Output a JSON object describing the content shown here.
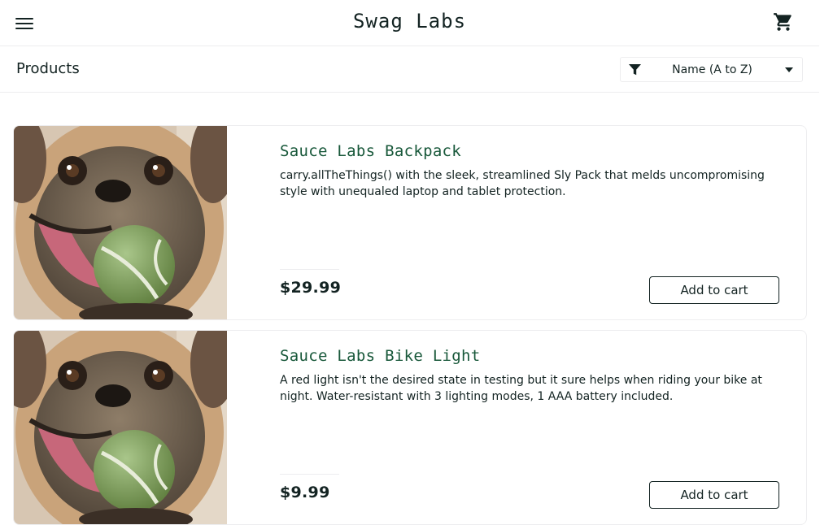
{
  "header": {
    "title": "Swag Labs",
    "menu_icon": "hamburger-menu-icon",
    "cart_icon": "shopping-cart-icon"
  },
  "subheader": {
    "title": "Products",
    "sort": {
      "icon": "filter-icon",
      "selected": "Name (A to Z)"
    }
  },
  "products": [
    {
      "name": "Sauce Labs Backpack",
      "description": "carry.allTheThings() with the sleek, streamlined Sly Pack that melds uncompromising style with unequaled laptop and tablet protection.",
      "price": "$29.99",
      "button_label": "Add to cart",
      "image": "pug-with-tennis-ball"
    },
    {
      "name": "Sauce Labs Bike Light",
      "description": "A red light isn't the desired state in testing but it sure helps when riding your bike at night. Water-resistant with 3 lighting modes, 1 AAA battery included.",
      "price": "$9.99",
      "button_label": "Add to cart",
      "image": "pug-with-tennis-ball"
    }
  ],
  "colors": {
    "accent_green": "#18583a",
    "text_dark": "#132322",
    "border": "#ededef"
  }
}
